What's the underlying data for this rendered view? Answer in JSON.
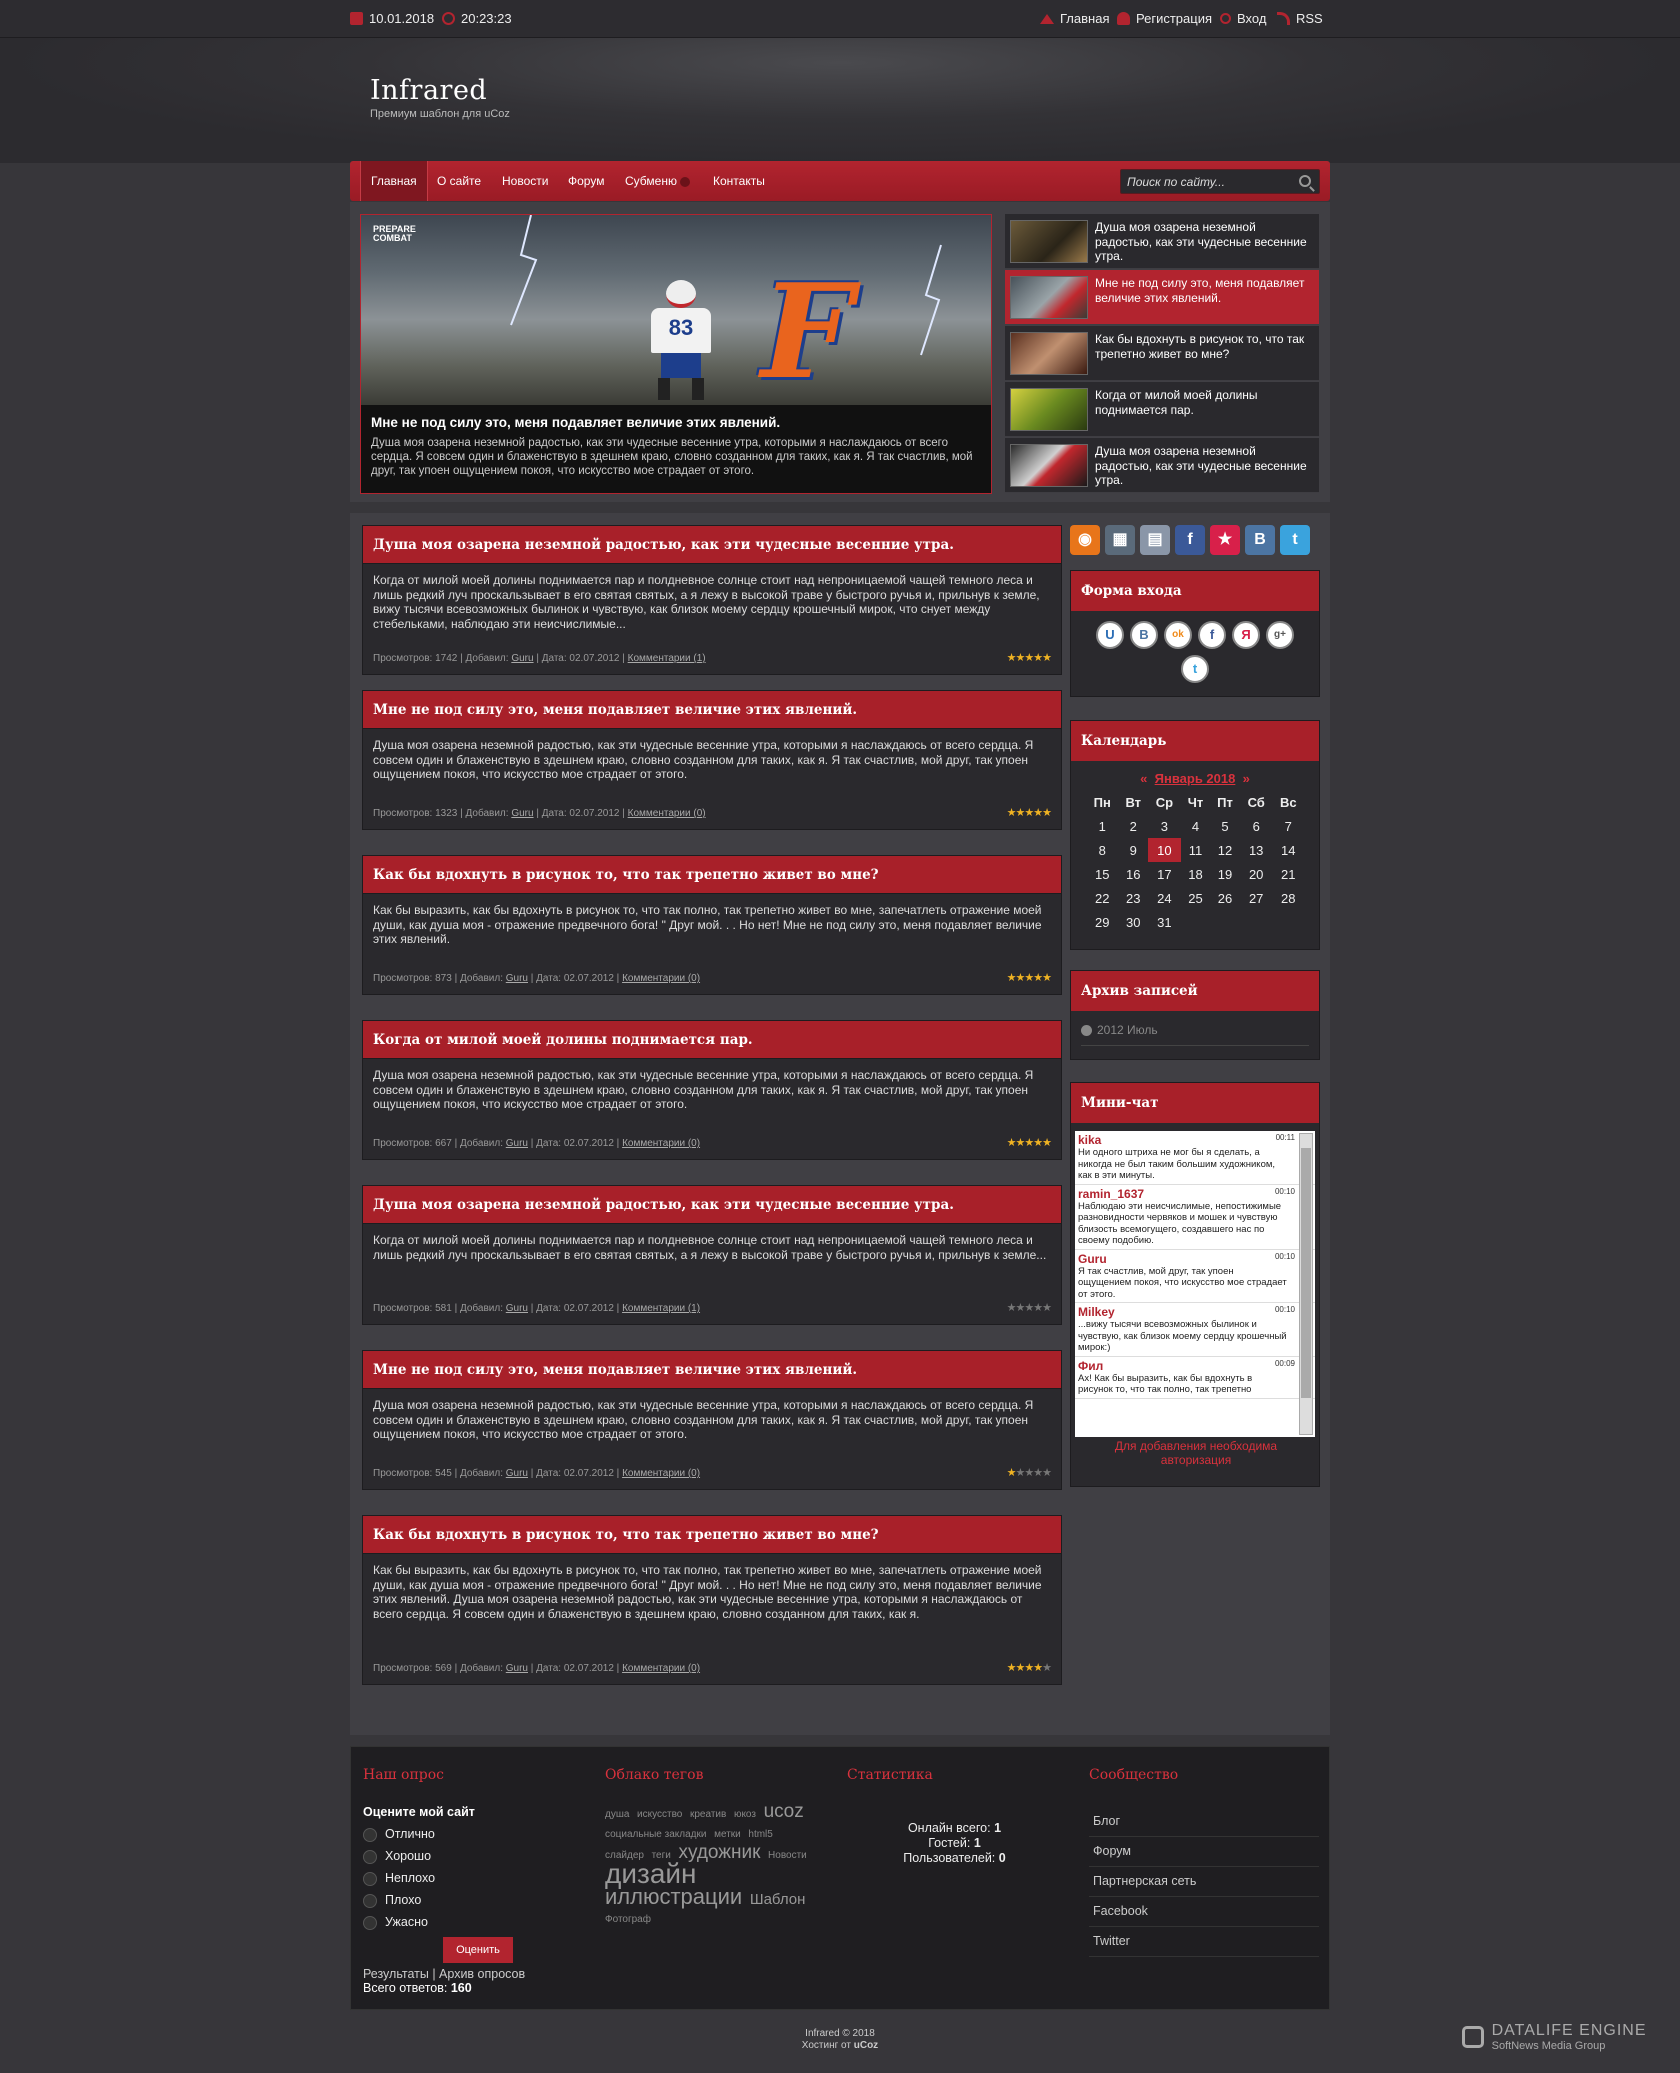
{
  "topbar": {
    "date": "10.01.2018",
    "time": "20:23:23",
    "home": "Главная",
    "register": "Регистрация",
    "login": "Вход",
    "rss": "RSS"
  },
  "brand": {
    "logo": "Infrared",
    "tagline": "Премиум шаблон для uCoz"
  },
  "nav": {
    "items": [
      "Главная",
      "О сайте",
      "Новости",
      "Форум",
      "Субменю",
      "Контакты"
    ],
    "search_placeholder": "Поиск по сайту..."
  },
  "slider": {
    "title": "Мне не под силу это, меня подавляет величие этих явлений.",
    "text": "Душа моя озарена неземной радостью, как эти чудесные весенние утра, которыми я наслаждаюсь от всего сердца. Я совсем один и блаженствую в здешнем краю, словно созданном для таких, как я. Я так счастлив, мой друг, так упоен ощущением покоя, что искусство мое страдает от этого.",
    "logo_text": "PREPARE COMBAT",
    "jersey": "83",
    "thumbs": [
      "Душа моя озарена неземной радостью, как эти чудесные весенние утра.",
      "Мне не под силу это, меня подавляет величие этих явлений.",
      "Как бы вдохнуть в рисунок то, что так трепетно живет во мне?",
      "Когда от милой моей долины поднимается пар.",
      "Душа моя озарена неземной радостью, как эти чудесные весенние утра."
    ]
  },
  "posts": [
    {
      "title": "Душа моя озарена неземной радостью, как эти чудесные весенние утра.",
      "body": "Когда от милой моей долины поднимается пар и полдневное солнце стоит над непроницаемой чащей темного леса и лишь редкий луч проскальзывает в его святая святых, а я лежу в высокой траве у быстрого ручья и, прильнув к земле, вижу тысячи всевозможных былинок и чувствую, как близок моему сердцу крошечный мирок, что снует между стебельками, наблюдаю эти неисчислимые...",
      "views": "Просмотров: 1742",
      "author": "Guru",
      "date": "Дата: 02.07.2012",
      "comments": "Комментарии (1)",
      "rating": 4.5
    },
    {
      "title": "Мне не под силу это, меня подавляет величие этих явлений.",
      "body": "Душа моя озарена неземной радостью, как эти чудесные весенние утра, которыми я наслаждаюсь от всего сердца. Я совсем один и блаженствую в здешнем краю, словно созданном для таких, как я. Я так счастлив, мой друг, так упоен ощущением покоя, что искусство мое страдает от этого.",
      "views": "Просмотров: 1323",
      "author": "Guru",
      "date": "Дата: 02.07.2012",
      "comments": "Комментарии (0)",
      "rating": 5
    },
    {
      "title": "Как бы вдохнуть в рисунок то, что так трепетно живет во мне?",
      "body": "Как бы выразить, как бы вдохнуть в рисунок то, что так полно, так трепетно живет во мне, запечатлеть отражение моей души, как душа моя - отражение предвечного бога! \" Друг мой. . . Но нет! Мне не под силу это, меня подавляет величие этих явлений.",
      "views": "Просмотров: 873",
      "author": "Guru",
      "date": "Дата: 02.07.2012",
      "comments": "Комментарии (0)",
      "rating": 5
    },
    {
      "title": "Когда от милой моей долины поднимается пар.",
      "body": "Душа моя озарена неземной радостью, как эти чудесные весенние утра, которыми я наслаждаюсь от всего сердца. Я совсем один и блаженствую в здешнем краю, словно созданном для таких, как я. Я так счастлив, мой друг, так упоен ощущением покоя, что искусство мое страдает от этого.",
      "views": "Просмотров: 667",
      "author": "Guru",
      "date": "Дата: 02.07.2012",
      "comments": "Комментарии (0)",
      "rating": 5
    },
    {
      "title": "Душа моя озарена неземной радостью, как эти чудесные весенние утра.",
      "body": "Когда от милой моей долины поднимается пар и полдневное солнце стоит над непроницаемой чащей темного леса и лишь редкий луч проскальзывает в его святая святых, а я лежу в высокой траве у быстрого ручья и, прильнув к земле...",
      "views": "Просмотров: 581",
      "author": "Guru",
      "date": "Дата: 02.07.2012",
      "comments": "Комментарии (1)",
      "rating": 0
    },
    {
      "title": "Мне не под силу это, меня подавляет величие этих явлений.",
      "body": "Душа моя озарена неземной радостью, как эти чудесные весенние утра, которыми я наслаждаюсь от всего сердца. Я совсем один и блаженствую в здешнем краю, словно созданном для таких, как я. Я так счастлив, мой друг, так упоен ощущением покоя, что искусство мое страдает от этого.",
      "views": "Просмотров: 545",
      "author": "Guru",
      "date": "Дата: 02.07.2012",
      "comments": "Комментарии (0)",
      "rating": 1
    },
    {
      "title": "Как бы вдохнуть в рисунок то, что так трепетно живет во мне?",
      "body": "Как бы выразить, как бы вдохнуть в рисунок то, что так полно, так трепетно живет во мне, запечатлеть отражение моей души, как душа моя - отражение предвечного бога! \" Друг мой. . . Но нет! Мне не под силу это, меня подавляет величие этих явлений. Душа моя озарена неземной радостью, как эти чудесные весенние утра, которыми я наслаждаюсь от всего сердца. Я совсем один и блаженствую в здешнем краю, словно созданном для таких, как я.",
      "views": "Просмотров: 569",
      "author": "Guru",
      "date": "Дата: 02.07.2012",
      "comments": "Комментарии (0)",
      "rating": 4
    }
  ],
  "added_by": "Добавил:",
  "login_block": {
    "title": "Форма входа",
    "providers": [
      "U",
      "B",
      "ok",
      "f",
      "Я",
      "g+",
      "t"
    ]
  },
  "calendar": {
    "title": "Календарь",
    "prev": "«",
    "month": "Январь 2018",
    "next": "»",
    "days": [
      "Пн",
      "Вт",
      "Ср",
      "Чт",
      "Пт",
      "Сб",
      "Вс"
    ],
    "today": "10",
    "weeks": [
      [
        "1",
        "2",
        "3",
        "4",
        "5",
        "6",
        "7"
      ],
      [
        "8",
        "9",
        "10",
        "11",
        "12",
        "13",
        "14"
      ],
      [
        "15",
        "16",
        "17",
        "18",
        "19",
        "20",
        "21"
      ],
      [
        "22",
        "23",
        "24",
        "25",
        "26",
        "27",
        "28"
      ],
      [
        "29",
        "30",
        "31",
        "",
        "",
        "",
        ""
      ]
    ]
  },
  "archive": {
    "title": "Архив записей",
    "item": "2012 Июль"
  },
  "chat": {
    "title": "Мини-чат",
    "notice": "Для добавления необходима авторизация",
    "messages": [
      {
        "user": "kika",
        "time": "00:11",
        "text": "Ни одного штриха не мог бы я сделать, а никогда не был таким большим художником, как в эти минуты."
      },
      {
        "user": "ramin_1637",
        "time": "00:10",
        "text": "Наблюдаю эти неисчислимые, непостижимые разновидности червяков и мошек и чувствую близость всемогущего, создавшего нас по своему подобию."
      },
      {
        "user": "Guru",
        "time": "00:10",
        "text": "Я так счастлив, мой друг, так упоен ощущением покоя, что искусство мое страдает от этого."
      },
      {
        "user": "Milkey",
        "time": "00:10",
        "text": "...вижу тысячи всевозможных былинок и чувствую, как близок моему сердцу крошечный мирок:)"
      },
      {
        "user": "Фил",
        "time": "00:09",
        "text": "Ах! Как бы выразить, как бы вдохнуть в рисунок то, что так полно, так трепетно"
      }
    ]
  },
  "poll": {
    "title": "Наш опрос",
    "question": "Оцените мой сайт",
    "options": [
      "Отлично",
      "Хорошо",
      "Неплохо",
      "Плохо",
      "Ужасно"
    ],
    "button": "Оценить",
    "results": "Результаты",
    "archive": "Архив опросов",
    "total_label": "Всего ответов:",
    "total": "160"
  },
  "tags": {
    "title": "Облако тегов",
    "items": [
      [
        "душа",
        10
      ],
      [
        "искусство",
        10
      ],
      [
        "креатив",
        10
      ],
      [
        "юкоз",
        10
      ],
      [
        "ucoz",
        19
      ],
      [
        "социальные закладки",
        10
      ],
      [
        "метки",
        10
      ],
      [
        "html5",
        10
      ],
      [
        "слайдер",
        10
      ],
      [
        "теги",
        10
      ],
      [
        "художник",
        19
      ],
      [
        "Новости",
        10
      ],
      [
        "дизайн",
        28
      ],
      [
        "иллюстрации",
        22
      ],
      [
        "Шаблон",
        15
      ],
      [
        "Фотограф",
        10
      ]
    ]
  },
  "stats": {
    "title": "Статистика",
    "online_label": "Онлайн всего:",
    "online": "1",
    "guests_label": "Гостей:",
    "guests": "1",
    "users_label": "Пользователей:",
    "users": "0"
  },
  "community": {
    "title": "Сообщество",
    "links": [
      "Блог",
      "Форум",
      "Партнерская сеть",
      "Facebook",
      "Twitter"
    ]
  },
  "footer": {
    "line1": "Infrared © 2018",
    "hosting_label": "Хостинг от",
    "hosting": "uCoz",
    "dle_brand": "DATALIFE ENGINE",
    "dle_sub": "SoftNews Media Group"
  },
  "colors": {
    "accent": "#b2242f",
    "background": "#37363a",
    "panel": "#2a292d"
  }
}
